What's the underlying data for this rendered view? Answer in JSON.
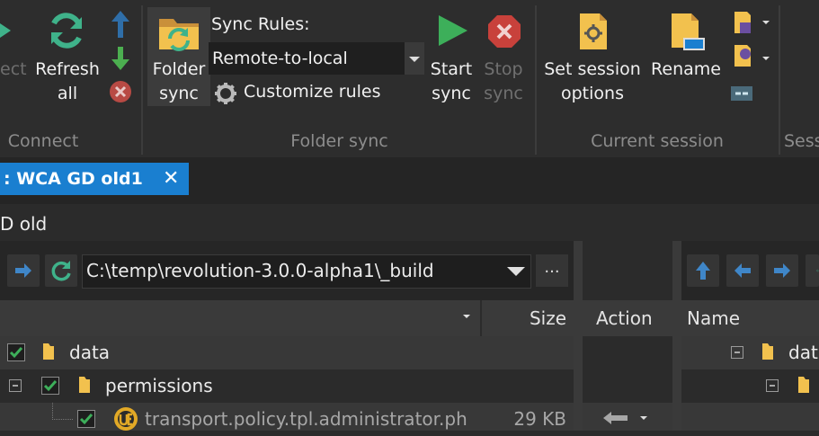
{
  "ribbon": {
    "connect_group": {
      "partial_label": "ect",
      "refresh_label_1": "Refresh",
      "refresh_label_2": "all",
      "caption": "Connect"
    },
    "folder_sync_group": {
      "folder_sync_label_1": "Folder",
      "folder_sync_label_2": "sync",
      "sync_rules_label": "Sync Rules:",
      "sync_rules_value": "Remote-to-local",
      "customize_rules_label": "Customize rules",
      "start_sync_label_1": "Start",
      "start_sync_label_2": "sync",
      "stop_sync_label_1": "Stop",
      "stop_sync_label_2": "sync",
      "caption": "Folder sync"
    },
    "current_session_group": {
      "set_options_label_1": "Set session",
      "set_options_label_2": "options",
      "rename_label": "Rename",
      "caption": "Current session"
    },
    "next_group_caption": "Sess"
  },
  "tabs": [
    {
      "label": ": WCA GD old1",
      "active": true
    }
  ],
  "session_title": "D old",
  "left_panel": {
    "path": "C:\\temp\\revolution-3.0.0-alpha1\\_build",
    "more_label": "...",
    "columns": {
      "size": "Size"
    },
    "rows": [
      {
        "name": "data",
        "size": "",
        "checked": true,
        "level": 0
      },
      {
        "name": "permissions",
        "size": "",
        "checked": true,
        "level": 1
      },
      {
        "name": "transport.policy.tpl.administrator.ph",
        "size": "29 KB",
        "checked": true,
        "level": 2
      }
    ]
  },
  "middle_panel": {
    "column": "Action"
  },
  "right_panel": {
    "column": "Name",
    "rows": [
      {
        "name": "dat"
      }
    ]
  },
  "colors": {
    "accent": "#1a7fd0",
    "start_green": "#3daf5a",
    "stop_red": "#c8413b",
    "folder_yellow": "#f2c14e",
    "refresh_teal": "#3fb28a"
  }
}
